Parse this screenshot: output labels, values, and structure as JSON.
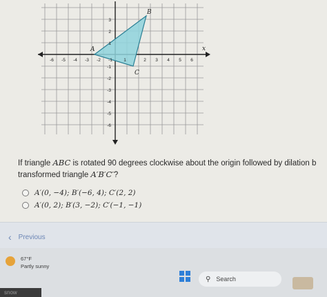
{
  "graph": {
    "x_ticks": [
      "-6",
      "-5",
      "-4",
      "-3",
      "-2",
      "-1",
      "1",
      "2",
      "3",
      "4",
      "5",
      "6"
    ],
    "y_ticks": [
      "3",
      "2",
      "1",
      "-1",
      "-2",
      "-3",
      "-4",
      "-5",
      "-6"
    ],
    "x_axis_label": "x",
    "vertices": {
      "A": "A",
      "B": "B",
      "C": "C"
    }
  },
  "question": {
    "text_1": "If triangle ",
    "abc": "ABC",
    "text_2": " is rotated 90 degrees clockwise about the origin followed by dilation b",
    "text_3": "transformed triangle ",
    "aprime": "A′B′C′",
    "text_4": "?"
  },
  "options": [
    {
      "text": "A′(0, −4); B′(−6, 4); C′(2, 2)"
    },
    {
      "text": "A′(0, 2); B′(3, −2); C′(−1, −1)"
    }
  ],
  "nav": {
    "previous": "Previous"
  },
  "taskbar": {
    "temperature": "67°F",
    "weather": "Partly sunny",
    "search": "Search",
    "corner": "snow"
  },
  "colors": {
    "triangle_fill": "#8fd3dc",
    "triangle_stroke": "#2b7f94"
  }
}
